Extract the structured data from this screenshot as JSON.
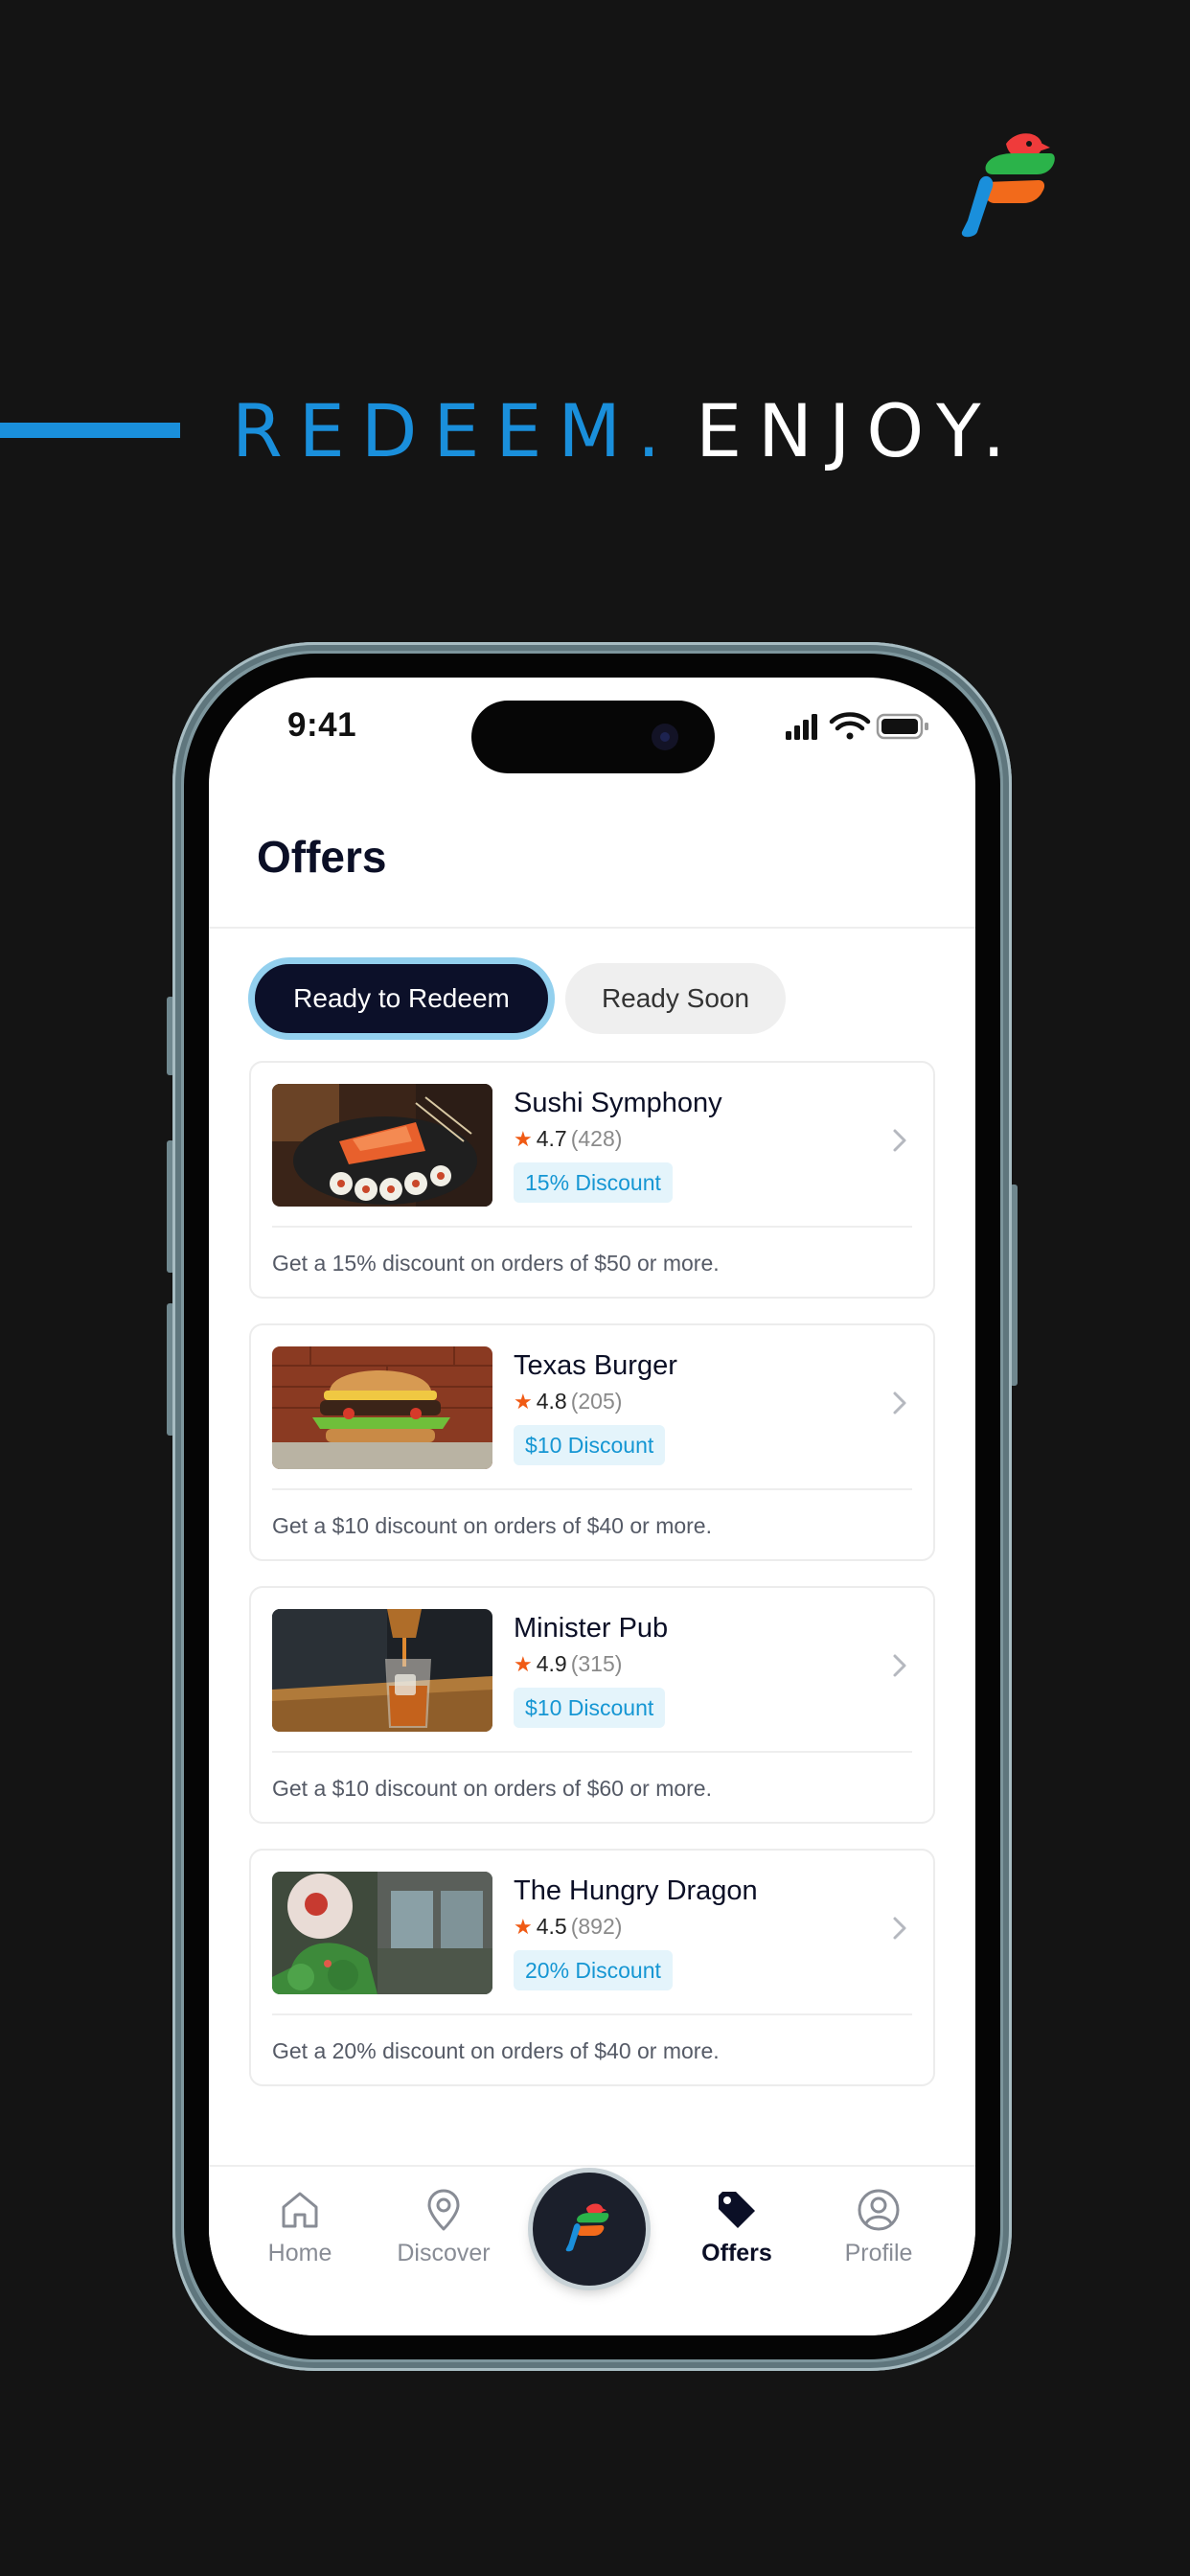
{
  "headline": {
    "part_a": "REDEEM.",
    "part_b": "ENJOY."
  },
  "status_bar": {
    "time": "9:41"
  },
  "screen": {
    "title": "Offers"
  },
  "tabs": [
    {
      "label": "Ready to Redeem",
      "active": true
    },
    {
      "label": "Ready Soon",
      "active": false
    }
  ],
  "offers": [
    {
      "name": "Sushi Symphony",
      "rating": "4.7",
      "reviews": "(428)",
      "badge": "15% Discount",
      "description": "Get a 15% discount on orders of $50 or more.",
      "image_icon": "sushi-photo"
    },
    {
      "name": "Texas Burger",
      "rating": "4.8",
      "reviews": "(205)",
      "badge": "$10 Discount",
      "description": "Get a $10 discount on orders of $40 or more.",
      "image_icon": "burger-photo"
    },
    {
      "name": "Minister Pub",
      "rating": "4.9",
      "reviews": "(315)",
      "badge": "$10 Discount",
      "description": "Get a $10 discount on orders of $60 or more.",
      "image_icon": "whiskey-photo"
    },
    {
      "name": "The Hungry Dragon",
      "rating": "4.5",
      "reviews": "(892)",
      "badge": "20% Discount",
      "description": "Get a 20% discount on orders of $40 or more.",
      "image_icon": "restaurant-photo"
    }
  ],
  "nav": {
    "items": [
      {
        "label": "Home",
        "icon": "home-icon",
        "active": false
      },
      {
        "label": "Discover",
        "icon": "location-pin-icon",
        "active": false
      },
      {
        "label": "Offers",
        "icon": "tag-icon",
        "active": true
      },
      {
        "label": "Profile",
        "icon": "profile-icon",
        "active": false
      }
    ]
  },
  "colors": {
    "background": "#141414",
    "accent_blue": "#1a8fdb",
    "navy": "#0c1029",
    "badge_bg": "#e4f4fb",
    "badge_text": "#1596d3",
    "star": "#f05a14",
    "logo_red": "#ef3b3b",
    "logo_green": "#2bb34a",
    "logo_orange": "#f26a1b",
    "logo_blue": "#1a8fdb"
  }
}
